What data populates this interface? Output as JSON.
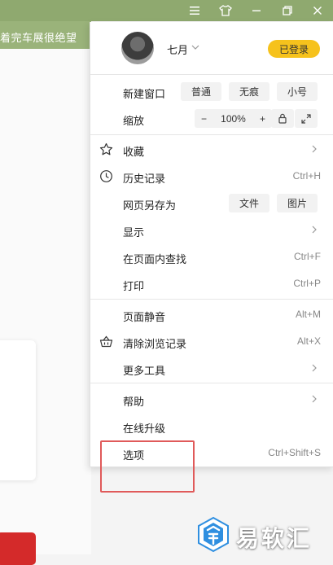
{
  "background": {
    "tab_text": "着完车展很绝望"
  },
  "titlebar": {
    "icons": [
      "menu-icon",
      "skin-icon",
      "minimize-icon",
      "restore-icon",
      "close-icon"
    ]
  },
  "profile": {
    "username": "七月",
    "login_status": "已登录"
  },
  "new_window": {
    "label": "新建窗口",
    "options": [
      "普通",
      "无痕",
      "小号"
    ]
  },
  "zoom": {
    "label": "缩放",
    "minus": "−",
    "value": "100%",
    "plus": "+"
  },
  "items": {
    "favorites": "收藏",
    "history": {
      "label": "历史记录",
      "shortcut": "Ctrl+H"
    },
    "save_as": {
      "label": "网页另存为",
      "options": [
        "文件",
        "图片"
      ]
    },
    "display": "显示",
    "find": {
      "label": "在页面内查找",
      "shortcut": "Ctrl+F"
    },
    "print": {
      "label": "打印",
      "shortcut": "Ctrl+P"
    },
    "mute": {
      "label": "页面静音",
      "shortcut": "Alt+M"
    },
    "clear": {
      "label": "清除浏览记录",
      "shortcut": "Alt+X"
    },
    "more_tools": "更多工具",
    "help": "帮助",
    "upgrade": "在线升级",
    "options": {
      "label": "选项",
      "shortcut": "Ctrl+Shift+S"
    }
  },
  "watermark": {
    "text": "易软汇"
  },
  "colors": {
    "titlebar": "#8fa96f",
    "login_badge": "#f6c21c",
    "highlight_box": "#e05a5a",
    "watermark_blue": "#2f8fe0"
  }
}
